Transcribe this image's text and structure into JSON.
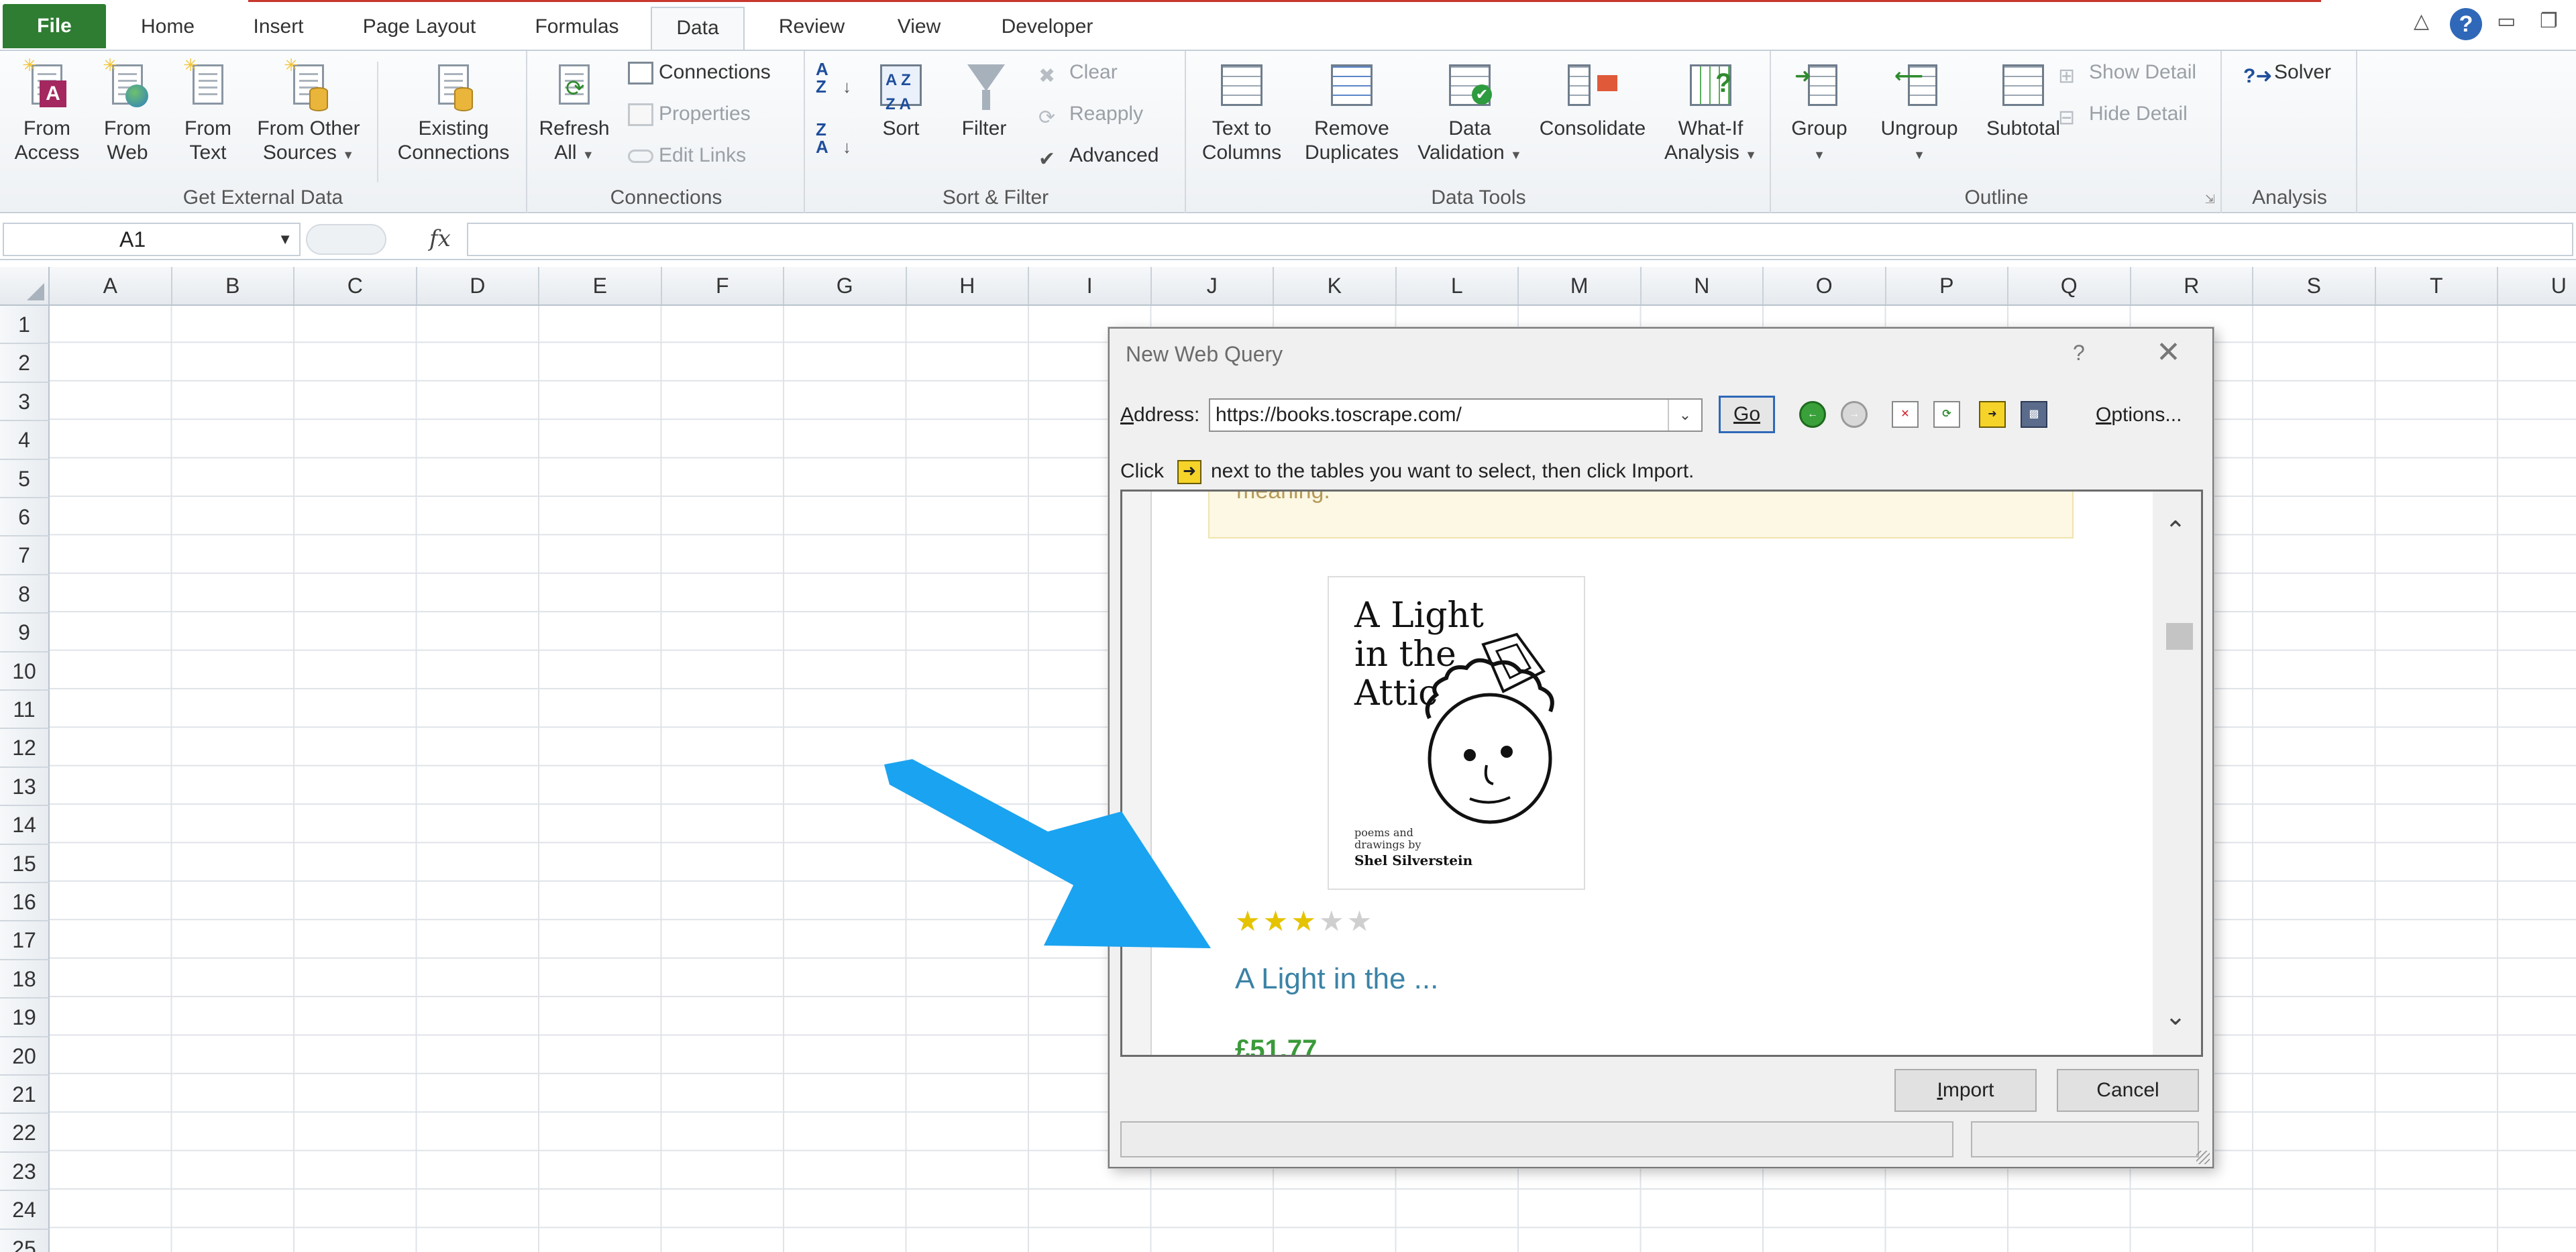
{
  "ribbon": {
    "tabs": [
      "File",
      "Home",
      "Insert",
      "Page Layout",
      "Formulas",
      "Data",
      "Review",
      "View",
      "Developer"
    ],
    "active_tab": "Data",
    "groups": {
      "get_external": {
        "label": "Get External Data",
        "from_access": [
          "From",
          "Access"
        ],
        "from_web": [
          "From",
          "Web"
        ],
        "from_text": [
          "From",
          "Text"
        ],
        "from_other": [
          "From Other",
          "Sources"
        ],
        "existing": [
          "Existing",
          "Connections"
        ]
      },
      "connections": {
        "label": "Connections",
        "refresh": [
          "Refresh",
          "All"
        ],
        "connections": "Connections",
        "properties": "Properties",
        "edit_links": "Edit Links"
      },
      "sort_filter": {
        "label": "Sort & Filter",
        "sort": "Sort",
        "filter": "Filter",
        "clear": "Clear",
        "reapply": "Reapply",
        "advanced": "Advanced"
      },
      "data_tools": {
        "label": "Data Tools",
        "text_to_columns": [
          "Text to",
          "Columns"
        ],
        "remove_duplicates": [
          "Remove",
          "Duplicates"
        ],
        "data_validation": [
          "Data",
          "Validation"
        ],
        "consolidate": "Consolidate",
        "what_if": [
          "What-If",
          "Analysis"
        ]
      },
      "outline": {
        "label": "Outline",
        "group": "Group",
        "ungroup": "Ungroup",
        "subtotal": "Subtotal",
        "show_detail": "Show Detail",
        "hide_detail": "Hide Detail"
      },
      "analysis": {
        "label": "Analysis",
        "solver": "Solver"
      }
    }
  },
  "formula_bar": {
    "name_box": "A1",
    "fx": "fx",
    "formula": ""
  },
  "grid": {
    "columns": [
      "A",
      "B",
      "C",
      "D",
      "E",
      "F",
      "G",
      "H",
      "I",
      "J",
      "K",
      "L",
      "M",
      "N",
      "O",
      "P",
      "Q",
      "R",
      "S",
      "T",
      "U"
    ],
    "rows": [
      "1",
      "2",
      "3",
      "4",
      "5",
      "6",
      "7",
      "8",
      "9",
      "10",
      "11",
      "12",
      "13",
      "14",
      "15",
      "16",
      "17",
      "18",
      "19",
      "20",
      "21",
      "22",
      "23",
      "24",
      "25"
    ]
  },
  "dialog": {
    "title": "New Web Query",
    "help": "?",
    "address_label": "Address:",
    "address_value": "https://books.toscrape.com/",
    "go": "Go",
    "options": "Options...",
    "instruction_pre": "Click",
    "instruction_post": "next to the tables you want to select, then click Import.",
    "import": "Import",
    "cancel": "Cancel",
    "preview": {
      "notice_text": "meaning.",
      "book_cover_title": [
        "A Light",
        "in the",
        "Attic"
      ],
      "book_cover_sub": [
        "poems and",
        "drawings by"
      ],
      "book_cover_author": "Shel Silverstein",
      "rating": 3,
      "rating_max": 5,
      "link_text": "A Light in the ...",
      "price": "£51.77"
    }
  },
  "colors": {
    "file_tab": "#2e7d32",
    "accent_blue": "#2f68b8",
    "arrow_blue": "#1aa3f0",
    "link": "#3b83a6",
    "price": "#3a9a3a",
    "star_on": "#e5c300"
  }
}
